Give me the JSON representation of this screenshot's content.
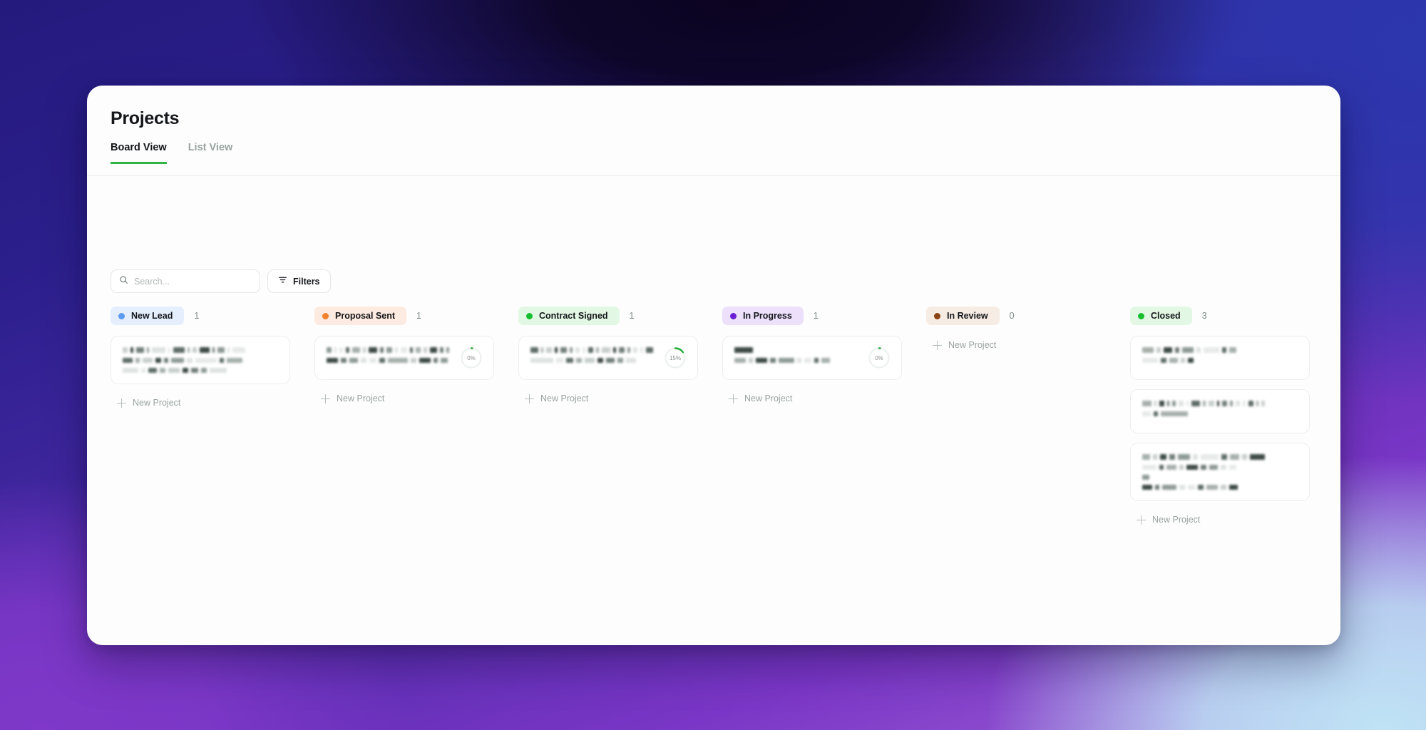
{
  "background": {
    "gradient_colors": [
      "#241a7d",
      "#0b0320",
      "#2c36ad",
      "#7a36c6",
      "#bfe3f5"
    ]
  },
  "header": {
    "title": "Projects",
    "tabs": [
      {
        "label": "Board View",
        "active": true
      },
      {
        "label": "List View",
        "active": false
      }
    ],
    "active_tab_underline_color": "#2fb344"
  },
  "toolbar": {
    "search": {
      "placeholder": "Search...",
      "value": "",
      "icon": "search-icon"
    },
    "filters": {
      "label": "Filters",
      "icon": "filter-icon"
    }
  },
  "board": {
    "new_project_label": "New Project",
    "columns": [
      {
        "status": "New Lead",
        "count": "1",
        "dot_color": "#5b9bf0",
        "pill_bg": "#e4eefd",
        "cards": [
          {
            "progress": null,
            "lines": [
              [
                14,
                6,
                22,
                6,
                36,
                6,
                30,
                6,
                10,
                28,
                6,
                18,
                6,
                34
              ],
              [
                14,
                6,
                14,
                8,
                6,
                18,
                8,
                30,
                6,
                22
              ],
              [
                22,
                6,
                12,
                8,
                16,
                8,
                10,
                8,
                24
              ]
            ]
          }
        ]
      },
      {
        "status": "Proposal Sent",
        "count": "1",
        "dot_color": "#f0822e",
        "pill_bg": "#fdeae0",
        "cards": [
          {
            "progress": "0%",
            "progress_value": 0,
            "lines": [
              [
                12,
                6,
                10,
                8,
                20,
                8,
                22,
                8,
                14,
                8,
                16,
                8,
                12,
                10,
                18,
                8,
                8
              ],
              [
                16,
                8,
                12,
                8,
                10,
                8,
                28,
                8,
                16,
                6,
                10
              ]
            ]
          }
        ]
      },
      {
        "status": "Contract Signed",
        "count": "1",
        "dot_color": "#17bf30",
        "pill_bg": "#e3f8e4",
        "cards": [
          {
            "progress": "15%",
            "progress_value": 15,
            "lines": [
              [
                20,
                6,
                14,
                8,
                16,
                8,
                10,
                8,
                12,
                8,
                22,
                8,
                14,
                8,
                10,
                8,
                18
              ],
              [
                32,
                10,
                10,
                8,
                14,
                8,
                12,
                8,
                14
              ]
            ]
          }
        ]
      },
      {
        "status": "In Progress",
        "count": "1",
        "dot_color": "#6b1fd4",
        "pill_bg": "#ece0fb",
        "cards": [
          {
            "progress": "0%",
            "progress_value": 0,
            "lines": [
              [
                26
              ],
              [
                16,
                6,
                16,
                8,
                22,
                6,
                10,
                6,
                12
              ]
            ]
          }
        ]
      },
      {
        "status": "In Review",
        "count": "0",
        "dot_color": "#8a4414",
        "pill_bg": "#f7ece4",
        "cards": []
      },
      {
        "status": "Closed",
        "count": "3",
        "dot_color": "#17bf30",
        "pill_bg": "#e3f8e4",
        "cards": [
          {
            "progress": null,
            "lines": [
              [
                16,
                6,
                12,
                6,
                16,
                6,
                22,
                6,
                10
              ],
              [
                22,
                8,
                12,
                6,
                8
              ]
            ]
          },
          {
            "progress": null,
            "lines": [
              [
                26,
                6,
                14,
                6,
                10,
                14,
                6,
                22,
                8,
                16,
                6,
                14,
                8,
                12,
                8,
                14,
                6,
                10
              ],
              [
                12,
                6,
                38
              ]
            ]
          },
          {
            "progress": null,
            "lines": [
              [
                12,
                6,
                10,
                8,
                18,
                8,
                26,
                8,
                14,
                8,
                22
              ],
              [
                20,
                6,
                14,
                6,
                16,
                8,
                12,
                8,
                10
              ],
              [
                10
              ],
              [
                14,
                6,
                20,
                8,
                10,
                8,
                16,
                8,
                12
              ]
            ]
          }
        ]
      }
    ]
  }
}
